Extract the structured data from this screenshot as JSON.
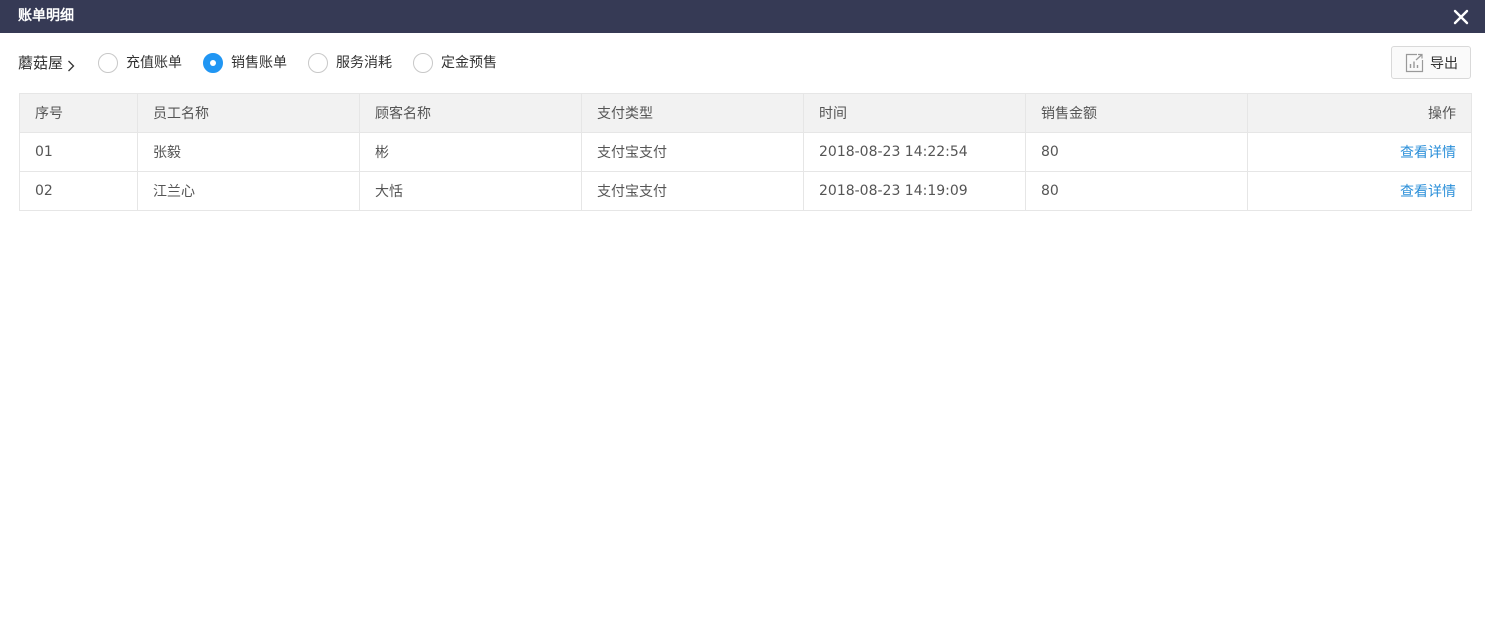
{
  "window": {
    "title": "账单明细"
  },
  "toolbar": {
    "shop_name": "蘑菇屋",
    "radios": [
      {
        "label": "充值账单",
        "checked": false
      },
      {
        "label": "销售账单",
        "checked": true
      },
      {
        "label": "服务消耗",
        "checked": false
      },
      {
        "label": "定金预售",
        "checked": false
      }
    ],
    "export_label": "导出"
  },
  "table": {
    "headers": [
      "序号",
      "员工名称",
      "顾客名称",
      "支付类型",
      "时间",
      "销售金额",
      "操作"
    ],
    "rows": [
      {
        "no": "01",
        "staff": "张毅",
        "customer": "彬",
        "pay_type": "支付宝支付",
        "time": "2018-08-23 14:22:54",
        "amount": "80",
        "action": "查看详情"
      },
      {
        "no": "02",
        "staff": "江兰心",
        "customer": "大恬",
        "pay_type": "支付宝支付",
        "time": "2018-08-23 14:19:09",
        "amount": "80",
        "action": "查看详情"
      }
    ]
  },
  "colors": {
    "titlebar": "#363a55",
    "accent": "#2196f3",
    "amount": "#e53935",
    "link": "#2b8fd9"
  }
}
